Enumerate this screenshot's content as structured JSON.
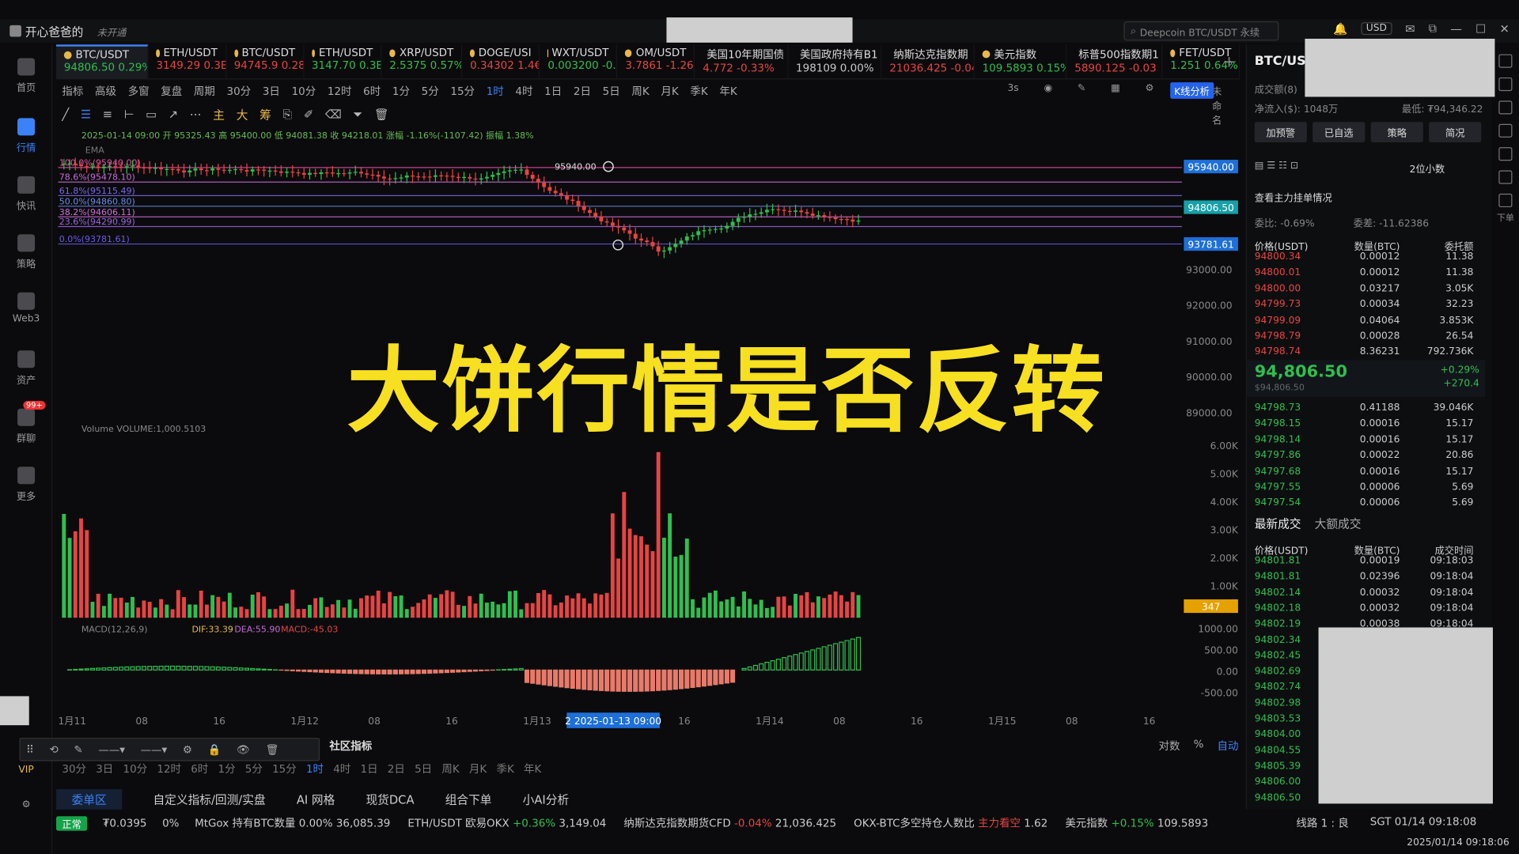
{
  "window": {
    "user": "开心爸爸的",
    "status": "未开通"
  },
  "search": {
    "placeholder": "Deepcoin BTC/USDT 永续"
  },
  "currency": "USD",
  "nav": [
    {
      "label": "首页"
    },
    {
      "label": "行情"
    },
    {
      "label": "快讯"
    },
    {
      "label": "策略"
    },
    {
      "label": "Web3"
    },
    {
      "label": "资产"
    },
    {
      "label": "群聊"
    },
    {
      "label": "更多"
    },
    {
      "label": "VIP"
    }
  ],
  "chat_badge": "99+",
  "tickers": [
    {
      "name": "BTC/USDT",
      "price": "94806.50",
      "chg": "0.29%",
      "dir": "up"
    },
    {
      "name": "ETH/USDT",
      "price": "3149.29",
      "chg": "0.3E",
      "dir": "dn"
    },
    {
      "name": "BTC/USDT",
      "price": "94745.9",
      "chg": "0.28",
      "dir": "dn"
    },
    {
      "name": "ETH/USDT",
      "price": "3147.70",
      "chg": "0.3E",
      "dir": "up"
    },
    {
      "name": "XRP/USDT",
      "price": "2.5375",
      "chg": "0.57%",
      "dir": "up"
    },
    {
      "name": "DOGE/USI",
      "price": "0.34302",
      "chg": "1.4€",
      "dir": "dn"
    },
    {
      "name": "WXT/USDT",
      "price": "0.003200",
      "chg": "-0.",
      "dir": "up"
    },
    {
      "name": "OM/USDT",
      "price": "3.7861",
      "chg": "-1.26",
      "dir": "dn"
    },
    {
      "name": "美国10年期国债",
      "price": "4.772",
      "chg": "-0.33%",
      "dir": "dn"
    },
    {
      "name": "美国政府持有B1",
      "price": "198109",
      "chg": "0.00%",
      "dir": "flat"
    },
    {
      "name": "纳斯达克指数期",
      "price": "21036.425",
      "chg": "-0.04",
      "dir": "dn"
    },
    {
      "name": "美元指数",
      "price": "109.5893",
      "chg": "0.15%",
      "dir": "up"
    },
    {
      "name": "标普500指数期1",
      "price": "5890.125",
      "chg": "-0.03",
      "dir": "dn"
    },
    {
      "name": "FET/USDT",
      "price": "1.251",
      "chg": "0.64%",
      "dir": "up"
    }
  ],
  "toolbar": {
    "indicators": "指标",
    "advanced": "高级",
    "multi": "多窗",
    "replay": "复盘",
    "period": "周期",
    "periods": [
      "30分",
      "3日",
      "10分",
      "12时",
      "6时",
      "1分",
      "5分",
      "15分",
      "1时",
      "4时",
      "1日",
      "2日",
      "5日",
      "周K",
      "月K",
      "季K",
      "年K"
    ],
    "selected_period": "1时",
    "refresh": "3s",
    "unnamed": "未命名",
    "kline_analysis": "K线分析"
  },
  "drawbar_labels": [
    "主",
    "大",
    "筹"
  ],
  "chart_info": {
    "ohlc_line": "2025-01-14 09:00 开 95325.43 高 95400.00 低 94081.38 收 94218.01 涨幅 -1.16%(-1107.42) 振幅 1.38%",
    "ema": "EMA",
    "fib_labels": [
      "100.0%(95940.00)",
      "78.6%(95478.10)",
      "61.8%(95115.49)",
      "50.0%(94860.80)",
      "38.2%(94606.11)",
      "23.6%(94290.99)",
      "0.0%(93781.61)"
    ],
    "volume_label": "Volume  VOLUME:1,000.5103",
    "macd_label": "MACD(12,26,9)",
    "macd_dif": "DIF:33.39",
    "macd_dea": "DEA:55.90",
    "macd_val": "MACD:-45.03",
    "high_marker": "95940.00",
    "price_tags": {
      "top": "95940.00",
      "last": "94806.50",
      "low": "93781.61",
      "vol": "347"
    },
    "time_tag": "2  2025-01-13 09:00",
    "headline": "大饼行情是否反转"
  },
  "chart_data": {
    "type": "candlestick",
    "y_ticks": [
      "93000.00",
      "92000.00",
      "91000.00",
      "90000.00",
      "89000.00"
    ],
    "vol_ticks": [
      "6.00K",
      "5.00K",
      "4.00K",
      "3.00K",
      "2.00K",
      "1.00K"
    ],
    "macd_ticks": [
      "1000.00",
      "500.00",
      "0.00",
      "-500.00"
    ],
    "x_ticks": [
      "1月11",
      "08",
      "16",
      "1月12",
      "08",
      "16",
      "1月13",
      "08",
      "16",
      "1月14",
      "08",
      "16",
      "1月15",
      "08",
      "16"
    ]
  },
  "bottom_bar": {
    "community": "社区指标",
    "log": "对数",
    "pct": "%",
    "auto": "自动"
  },
  "sub_periods": [
    "30分",
    "3日",
    "10分",
    "12时",
    "6时",
    "1分",
    "5分",
    "15分",
    "1时",
    "4时",
    "1日",
    "2日",
    "5日",
    "周K",
    "月K",
    "季K",
    "年K"
  ],
  "bottom_tabs": [
    "委单区",
    "自定义指标/回测/实盘",
    "AI 网格",
    "现货DCA",
    "组合下单",
    "小AI分析"
  ],
  "footer": {
    "status": "正常",
    "fee": "₮0.0395",
    "fee_pct": "0%",
    "items": [
      {
        "t": "MtGox 持有BTC数量",
        "a": "0.00%",
        "b": "36,085.39"
      },
      {
        "t": "ETH/USDT 欧易OKX",
        "a": "+0.36%",
        "b": "3,149.04"
      },
      {
        "t": "纳斯达克指数期货CFD",
        "a": "-0.04%",
        "b": "21,036.425"
      },
      {
        "t": "OKX-BTC多空持仓人数比",
        "a": "主力看空",
        "b": "1.62"
      },
      {
        "t": "美元指数",
        "a": "+0.15%",
        "b": "109.5893"
      }
    ],
    "line": "线路 1 : 良",
    "clock": "SGT 01/14 09:18:08",
    "datetime": "2025/01/14 09:18:06"
  },
  "right_panel": {
    "pair": "BTC/USD",
    "turnover_label": "成交额(8)",
    "netflow": "净流入($): 1048万",
    "low": "最低: ₮94,346.22",
    "buttons": [
      "加预警",
      "已自选",
      "策略",
      "简况"
    ],
    "decimals": "2位小数",
    "main_orders": "查看主力挂单情况",
    "ratio": "委比: -0.69%",
    "diff": "委差: -11.62386",
    "headers": [
      "价格(USDT)",
      "数量(BTC)",
      "委托额"
    ],
    "asks": [
      [
        "94800.34",
        "0.00012",
        "11.38"
      ],
      [
        "94800.01",
        "0.00012",
        "11.38"
      ],
      [
        "94800.00",
        "0.03217",
        "3.05K"
      ],
      [
        "94799.73",
        "0.00034",
        "32.23"
      ],
      [
        "94799.09",
        "0.04064",
        "3.853K"
      ],
      [
        "94798.79",
        "0.00028",
        "26.54"
      ],
      [
        "94798.74",
        "8.36231",
        "792.736K"
      ]
    ],
    "mid_price": "94,806.50",
    "mid_sub": "$94,806.50",
    "mid_chg": "+0.29%",
    "mid_chg2": "+270.4",
    "bids": [
      [
        "94798.73",
        "0.41188",
        "39.046K"
      ],
      [
        "94798.15",
        "0.00016",
        "15.17"
      ],
      [
        "94798.14",
        "0.00016",
        "15.17"
      ],
      [
        "94797.86",
        "0.00022",
        "20.86"
      ],
      [
        "94797.68",
        "0.00016",
        "15.17"
      ],
      [
        "94797.55",
        "0.00006",
        "5.69"
      ],
      [
        "94797.54",
        "0.00006",
        "5.69"
      ]
    ],
    "trade_tabs": [
      "最新成交",
      "大额成交"
    ],
    "trade_headers": [
      "价格(USDT)",
      "数量(BTC)",
      "成交时间"
    ],
    "trades": [
      [
        "94801.81",
        "0.00019",
        "09:18:03"
      ],
      [
        "94801.81",
        "0.02396",
        "09:18:04"
      ],
      [
        "94802.14",
        "0.00032",
        "09:18:04"
      ],
      [
        "94802.18",
        "0.00032",
        "09:18:04"
      ],
      [
        "94802.19",
        "0.00038",
        "09:18:04"
      ],
      [
        "94802.34",
        "",
        ""
      ],
      [
        "94802.45",
        "",
        ""
      ],
      [
        "94802.69",
        "",
        ""
      ],
      [
        "94802.74",
        "",
        ""
      ],
      [
        "94802.98",
        "",
        ""
      ],
      [
        "94803.53",
        "",
        ""
      ],
      [
        "94804.00",
        "",
        ""
      ],
      [
        "94804.55",
        "",
        ""
      ],
      [
        "94805.39",
        "",
        ""
      ],
      [
        "94806.00",
        "",
        ""
      ],
      [
        "94806.50",
        "",
        ""
      ]
    ]
  },
  "far_right": [
    "下单"
  ]
}
